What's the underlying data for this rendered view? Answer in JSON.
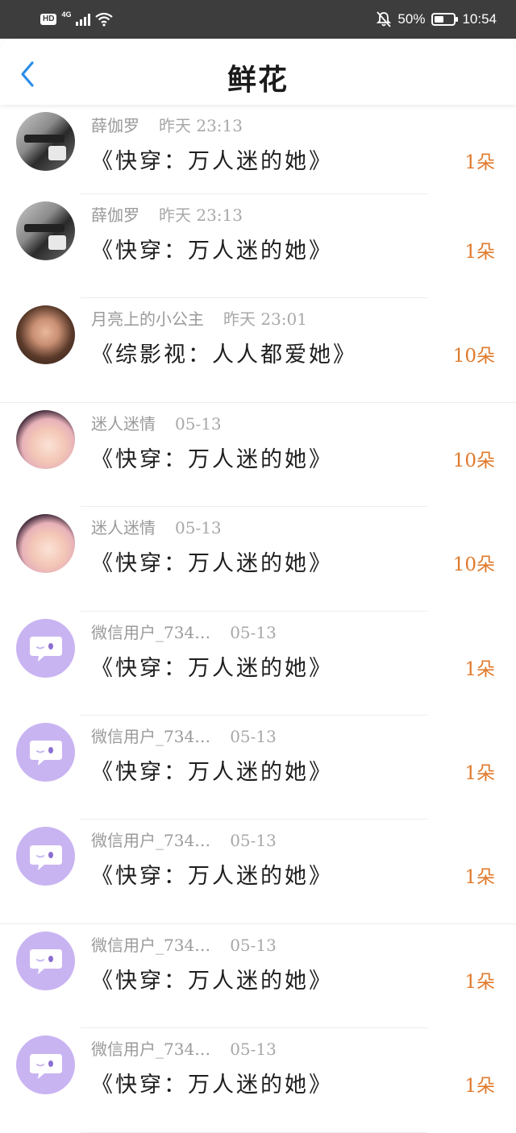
{
  "status_bar": {
    "hd": "HD",
    "network": "4G",
    "battery_percent": "50%",
    "battery_level": 0.5,
    "time": "10:54"
  },
  "header": {
    "title": "鲜花",
    "back_icon": "chevron-left-icon"
  },
  "colors": {
    "accent_blue": "#2b8de8",
    "count_orange": "#e07a2c",
    "wechat_avatar_purple": "#c9b4f2"
  },
  "items": [
    {
      "name": "薛伽罗",
      "time": "昨天 23:13",
      "book": "《快穿：万人迷的她》",
      "count": "1朵",
      "avatar": "photo-gym"
    },
    {
      "name": "薛伽罗",
      "time": "昨天 23:13",
      "book": "《快穿：万人迷的她》",
      "count": "1朵",
      "avatar": "photo-gym"
    },
    {
      "name": "月亮上的小公主",
      "time": "昨天 23:01",
      "book": "《综影视：人人都爱她》",
      "count": "10朵",
      "avatar": "photo-woman"
    },
    {
      "name": "迷人迷情",
      "time": "05-13",
      "book": "《快穿：万人迷的她》",
      "count": "10朵",
      "avatar": "anime"
    },
    {
      "name": "迷人迷情",
      "time": "05-13",
      "book": "《快穿：万人迷的她》",
      "count": "10朵",
      "avatar": "anime"
    },
    {
      "name": "微信用户_734…",
      "time": "05-13",
      "book": "《快穿：万人迷的她》",
      "count": "1朵",
      "avatar": "wechat-default"
    },
    {
      "name": "微信用户_734…",
      "time": "05-13",
      "book": "《快穿：万人迷的她》",
      "count": "1朵",
      "avatar": "wechat-default"
    },
    {
      "name": "微信用户_734…",
      "time": "05-13",
      "book": "《快穿：万人迷的她》",
      "count": "1朵",
      "avatar": "wechat-default"
    },
    {
      "name": "微信用户_734…",
      "time": "05-13",
      "book": "《快穿：万人迷的她》",
      "count": "1朵",
      "avatar": "wechat-default"
    },
    {
      "name": "微信用户_734…",
      "time": "05-13",
      "book": "《快穿：万人迷的她》",
      "count": "1朵",
      "avatar": "wechat-default"
    }
  ]
}
